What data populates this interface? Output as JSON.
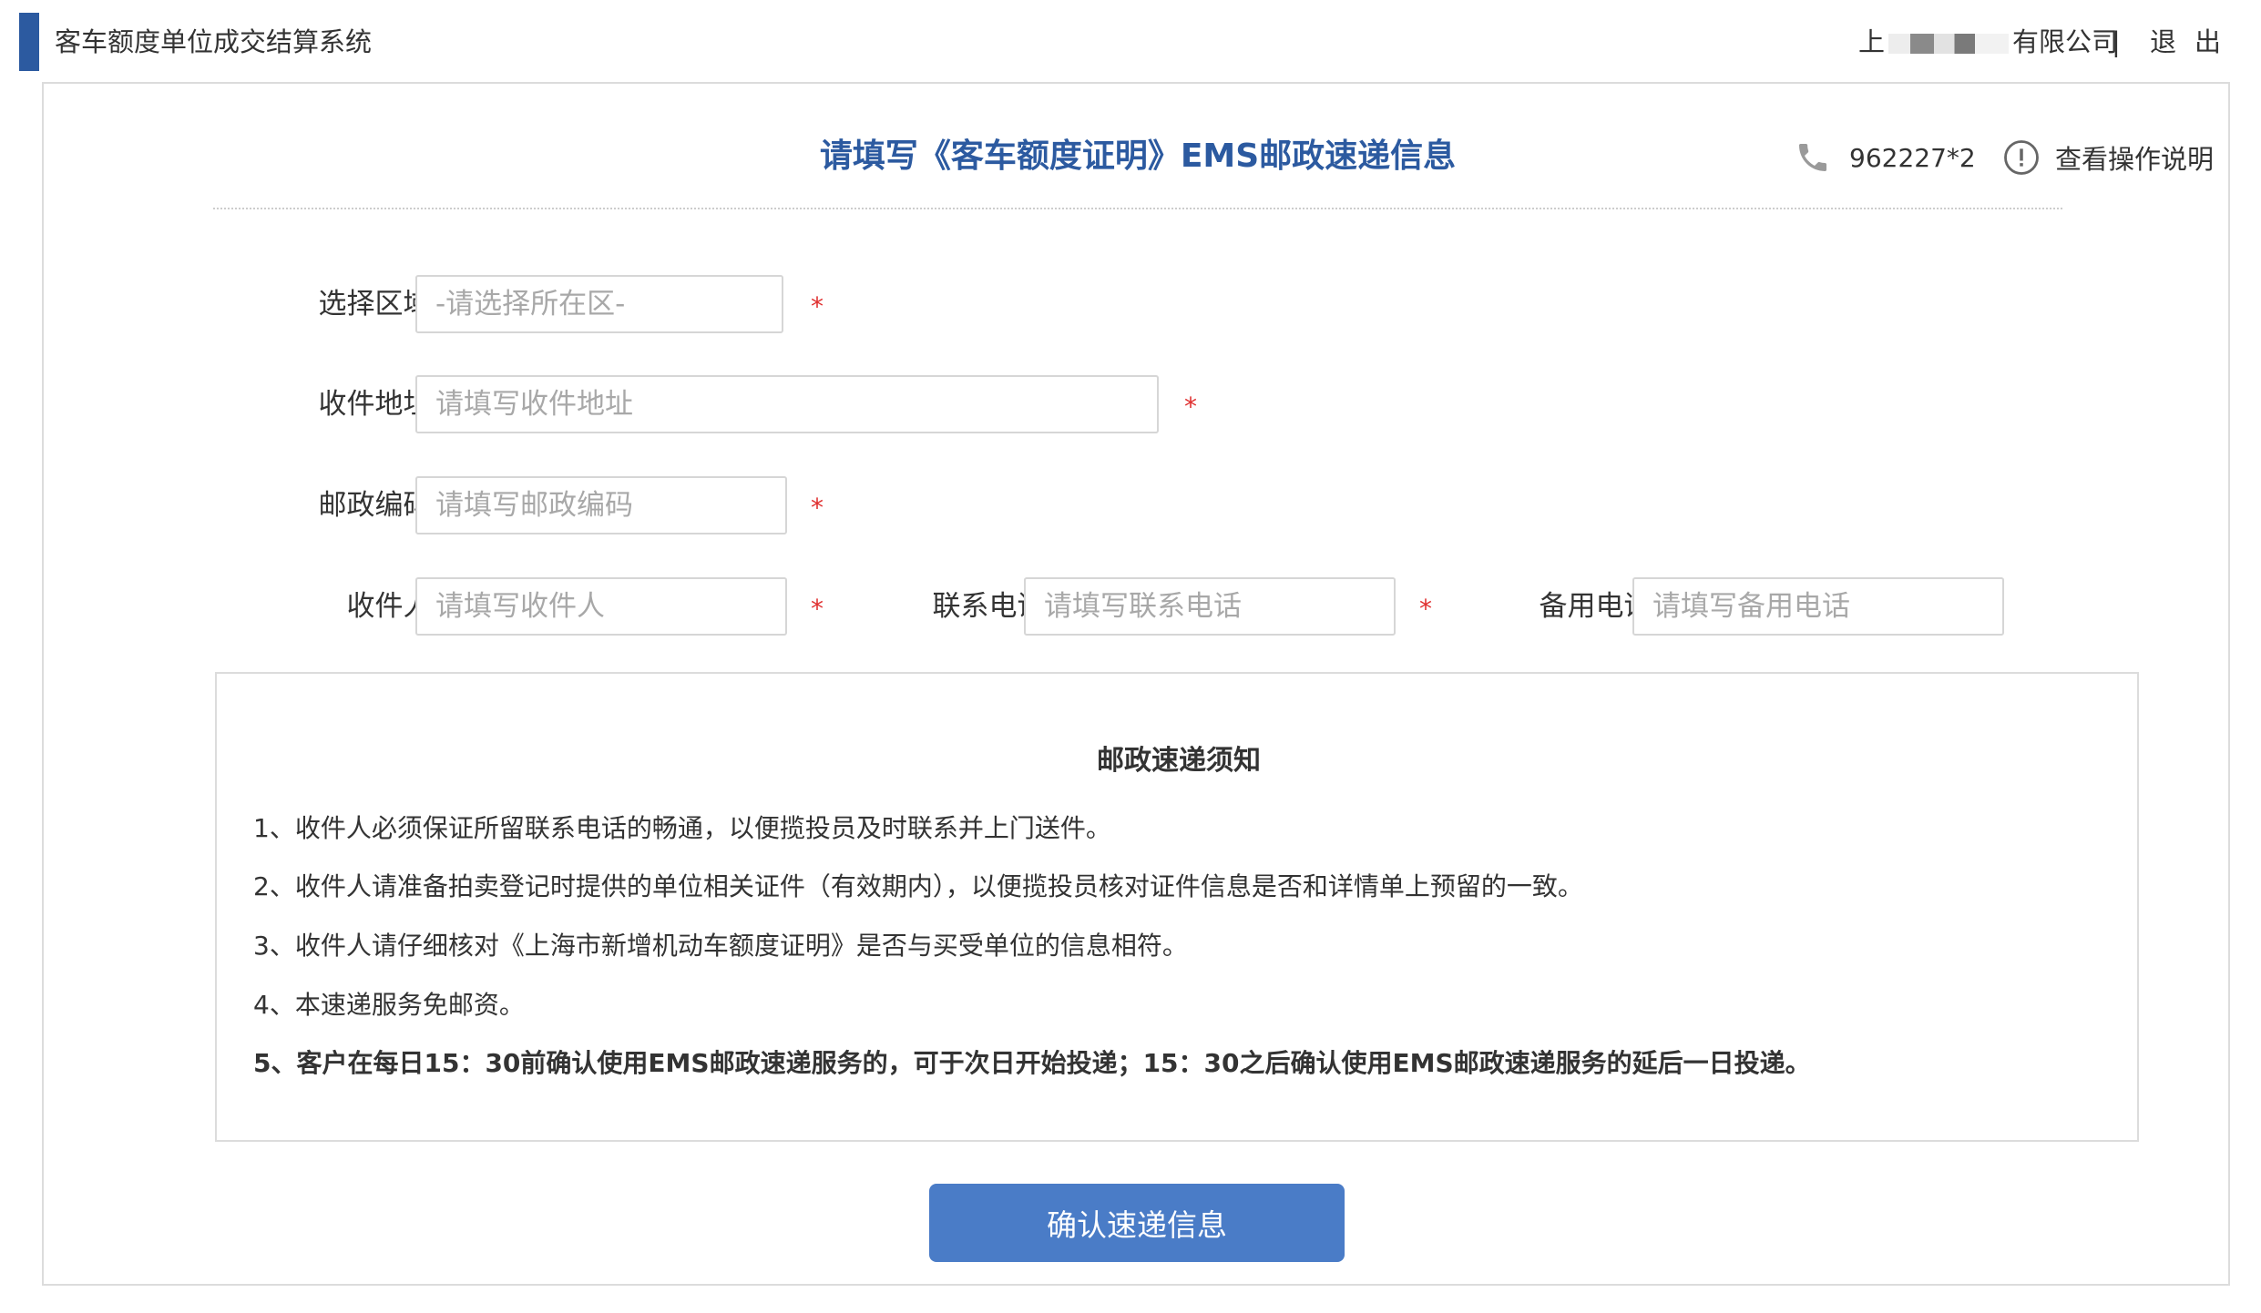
{
  "header": {
    "app_title": "客车额度单位成交结算系统",
    "company_prefix": "上",
    "company_suffix": "有限公司",
    "separator": "|",
    "logout_label": "退出"
  },
  "panel": {
    "title": "请填写《客车额度证明》EMS邮政速递信息",
    "phone_number": "962227*2",
    "help_label": "查看操作说明"
  },
  "form": {
    "region": {
      "label": "选择区域:",
      "placeholder": "-请选择所在区-",
      "required_mark": "*"
    },
    "address": {
      "label": "收件地址:",
      "placeholder": "请填写收件地址",
      "required_mark": "*"
    },
    "postcode": {
      "label": "邮政编码:",
      "placeholder": "请填写邮政编码",
      "required_mark": "*"
    },
    "recipient": {
      "label": "收件人:",
      "placeholder": "请填写收件人",
      "required_mark": "*"
    },
    "contact_phone": {
      "label": "联系电话:",
      "placeholder": "请填写联系电话",
      "required_mark": "*"
    },
    "backup_phone": {
      "label": "备用电话:",
      "placeholder": "请填写备用电话"
    }
  },
  "notice": {
    "title": "邮政速递须知",
    "items": [
      "1、收件人必须保证所留联系电话的畅通，以便揽投员及时联系并上门送件。",
      "2、收件人请准备拍卖登记时提供的单位相关证件（有效期内），以便揽投员核对证件信息是否和详情单上预留的一致。",
      "3、收件人请仔细核对《上海市新增机动车额度证明》是否与买受单位的信息相符。",
      "4、本速递服务免邮资。",
      "5、客户在每日15：30前确认使用EMS邮政速递服务的，可于次日开始投递；15：30之后确认使用EMS邮政速递服务的延后一日投递。"
    ]
  },
  "submit_label": "确认速递信息",
  "colors": {
    "accent": "#2c5aa0",
    "button": "#4a7cc7",
    "required": "#e03030"
  },
  "icons": {
    "phone": "phone-icon",
    "help": "info-circle-icon"
  }
}
